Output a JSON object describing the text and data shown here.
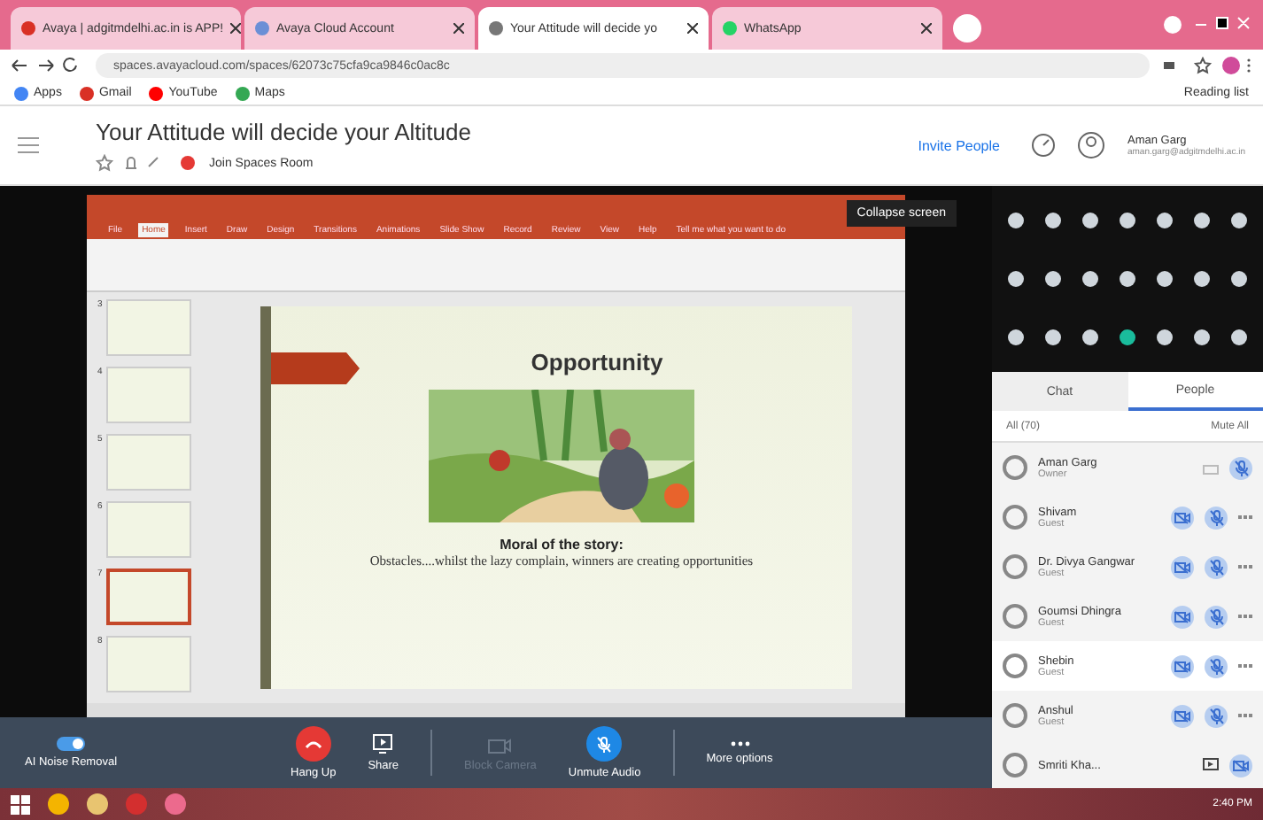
{
  "browser": {
    "tabs": [
      {
        "title": "Avaya | adgitmdelhi.ac.in is APP!",
        "selected": false
      },
      {
        "title": "Avaya Cloud Account",
        "selected": false
      },
      {
        "title": "Your Attitude will decide yo",
        "selected": true
      },
      {
        "title": "WhatsApp",
        "selected": false
      }
    ],
    "url": "spaces.avayacloud.com/spaces/62073c75cfa9ca9846c0ac8c",
    "bookmarks": [
      "Apps",
      "Gmail",
      "YouTube",
      "Maps"
    ],
    "reading_list": "Reading list"
  },
  "header": {
    "title": "Your Attitude will decide your Altitude",
    "join_room": "Join Spaces Room",
    "invite": "Invite People",
    "user_name": "Aman Garg",
    "user_email": "aman.garg@adgitmdelhi.ac.in"
  },
  "presentation": {
    "ribbon_tabs": [
      {
        "label": "File",
        "selected": false
      },
      {
        "label": "Home",
        "selected": true
      },
      {
        "label": "Insert",
        "selected": false
      },
      {
        "label": "Draw",
        "selected": false
      },
      {
        "label": "Design",
        "selected": false
      },
      {
        "label": "Transitions",
        "selected": false
      },
      {
        "label": "Animations",
        "selected": false
      },
      {
        "label": "Slide Show",
        "selected": false
      },
      {
        "label": "Record",
        "selected": false
      },
      {
        "label": "Review",
        "selected": false
      },
      {
        "label": "View",
        "selected": false
      },
      {
        "label": "Help",
        "selected": false
      }
    ],
    "tell_me": "Tell me what you want to do",
    "thumbnails": [
      {
        "number": "3",
        "selected": false
      },
      {
        "number": "4",
        "selected": false
      },
      {
        "number": "5",
        "selected": false
      },
      {
        "number": "6",
        "selected": false
      },
      {
        "number": "7",
        "selected": true
      },
      {
        "number": "8",
        "selected": false
      }
    ],
    "slide_title": "Opportunity",
    "moral": "Moral of the story:",
    "moral_text": "Obstacles....whilst the lazy complain, winners are creating opportunities"
  },
  "collapse": "Collapse screen",
  "panel": {
    "tabs": [
      {
        "label": "Chat",
        "selected": false
      },
      {
        "label": "People",
        "selected": true
      }
    ],
    "filter": "All (70)",
    "mute_all": "Mute All",
    "people": [
      {
        "name": "Aman Garg",
        "role": "Owner",
        "kind": "owner",
        "selected": false
      },
      {
        "name": "Shivam",
        "role": "Guest",
        "kind": "guest",
        "selected": false
      },
      {
        "name": "Dr. Divya Gangwar",
        "role": "Guest",
        "kind": "guest",
        "selected": false
      },
      {
        "name": "Goumsi Dhingra",
        "role": "Guest",
        "kind": "guest",
        "selected": false
      },
      {
        "name": "Shebin",
        "role": "Guest",
        "kind": "guest",
        "selected": true
      },
      {
        "name": "Anshul",
        "role": "Guest",
        "kind": "guest",
        "selected": false
      },
      {
        "name": "Smriti Kha...",
        "kind": "presenter",
        "selected": false
      }
    ]
  },
  "controls": {
    "noise": {
      "label": "AI Noise Removal",
      "on": true
    },
    "buttons": [
      {
        "label": "Hang Up",
        "kind": "hangup",
        "disabled": false
      },
      {
        "label": "Share",
        "kind": "share",
        "disabled": false
      },
      {
        "label": "Block Camera",
        "kind": "camera",
        "disabled": true
      },
      {
        "label": "Unmute Audio",
        "kind": "mic",
        "disabled": false
      },
      {
        "label": "More options",
        "kind": "more",
        "disabled": false
      }
    ]
  },
  "taskbar": {
    "time": "2:40 PM"
  }
}
